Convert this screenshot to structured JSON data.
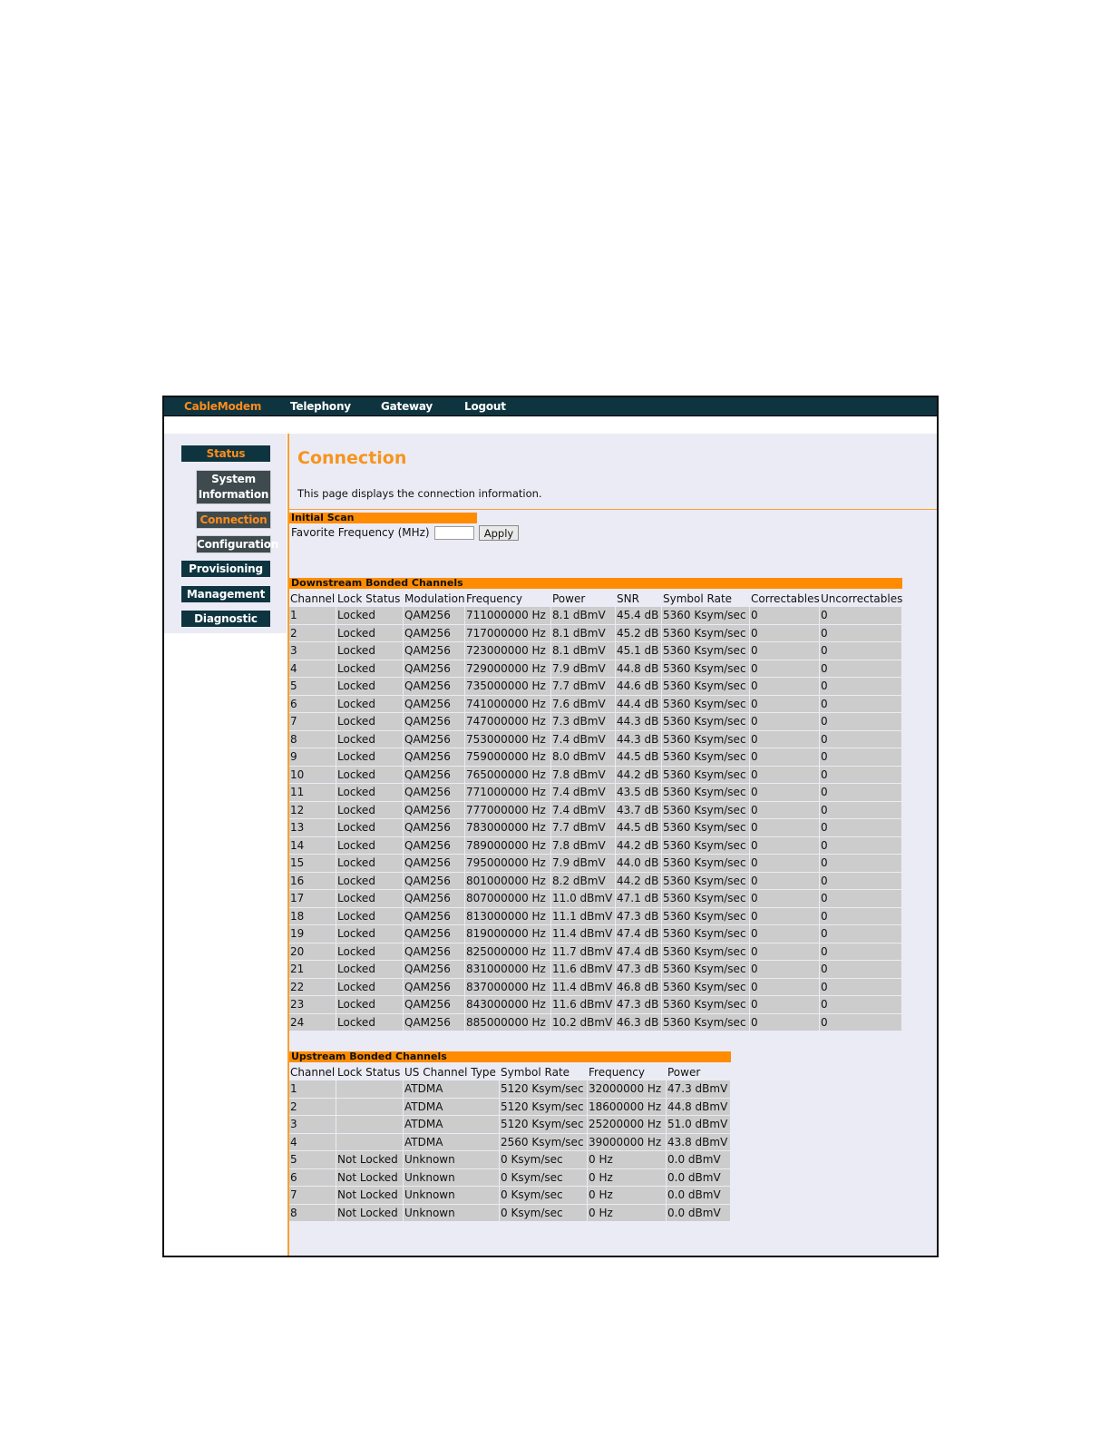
{
  "nav": {
    "tabs": [
      {
        "label": "CableModem",
        "active": true
      },
      {
        "label": "Telephony",
        "active": false
      },
      {
        "label": "Gateway",
        "active": false
      },
      {
        "label": "Logout",
        "active": false
      }
    ]
  },
  "sidebar": {
    "items": [
      {
        "label": "Status",
        "sub": false,
        "active": true
      },
      {
        "label": "System Information",
        "sub": true,
        "active": false
      },
      {
        "label": "Connection",
        "sub": true,
        "active": true
      },
      {
        "label": "Configuration",
        "sub": true,
        "active": false
      },
      {
        "label": "Provisioning",
        "sub": false,
        "active": false
      },
      {
        "label": "Management",
        "sub": false,
        "active": false
      },
      {
        "label": "Diagnostic",
        "sub": false,
        "active": false
      }
    ]
  },
  "page": {
    "title": "Connection",
    "description": "This page displays the connection information."
  },
  "initial_scan": {
    "heading": "Initial Scan",
    "favorite_label": "Favorite Frequency (MHz)",
    "favorite_value": "",
    "apply_label": "Apply"
  },
  "downstream": {
    "heading": "Downstream Bonded Channels",
    "columns": [
      "Channel",
      "Lock Status",
      "Modulation",
      "Frequency",
      "Power",
      "SNR",
      "Symbol Rate",
      "Correctables",
      "Uncorrectables"
    ],
    "rows": [
      [
        "1",
        "Locked",
        "QAM256",
        "711000000 Hz",
        "8.1 dBmV",
        "45.4 dB",
        "5360 Ksym/sec",
        "0",
        "0"
      ],
      [
        "2",
        "Locked",
        "QAM256",
        "717000000 Hz",
        "8.1 dBmV",
        "45.2 dB",
        "5360 Ksym/sec",
        "0",
        "0"
      ],
      [
        "3",
        "Locked",
        "QAM256",
        "723000000 Hz",
        "8.1 dBmV",
        "45.1 dB",
        "5360 Ksym/sec",
        "0",
        "0"
      ],
      [
        "4",
        "Locked",
        "QAM256",
        "729000000 Hz",
        "7.9 dBmV",
        "44.8 dB",
        "5360 Ksym/sec",
        "0",
        "0"
      ],
      [
        "5",
        "Locked",
        "QAM256",
        "735000000 Hz",
        "7.7 dBmV",
        "44.6 dB",
        "5360 Ksym/sec",
        "0",
        "0"
      ],
      [
        "6",
        "Locked",
        "QAM256",
        "741000000 Hz",
        "7.6 dBmV",
        "44.4 dB",
        "5360 Ksym/sec",
        "0",
        "0"
      ],
      [
        "7",
        "Locked",
        "QAM256",
        "747000000 Hz",
        "7.3 dBmV",
        "44.3 dB",
        "5360 Ksym/sec",
        "0",
        "0"
      ],
      [
        "8",
        "Locked",
        "QAM256",
        "753000000 Hz",
        "7.4 dBmV",
        "44.3 dB",
        "5360 Ksym/sec",
        "0",
        "0"
      ],
      [
        "9",
        "Locked",
        "QAM256",
        "759000000 Hz",
        "8.0 dBmV",
        "44.5 dB",
        "5360 Ksym/sec",
        "0",
        "0"
      ],
      [
        "10",
        "Locked",
        "QAM256",
        "765000000 Hz",
        "7.8 dBmV",
        "44.2 dB",
        "5360 Ksym/sec",
        "0",
        "0"
      ],
      [
        "11",
        "Locked",
        "QAM256",
        "771000000 Hz",
        "7.4 dBmV",
        "43.5 dB",
        "5360 Ksym/sec",
        "0",
        "0"
      ],
      [
        "12",
        "Locked",
        "QAM256",
        "777000000 Hz",
        "7.4 dBmV",
        "43.7 dB",
        "5360 Ksym/sec",
        "0",
        "0"
      ],
      [
        "13",
        "Locked",
        "QAM256",
        "783000000 Hz",
        "7.7 dBmV",
        "44.5 dB",
        "5360 Ksym/sec",
        "0",
        "0"
      ],
      [
        "14",
        "Locked",
        "QAM256",
        "789000000 Hz",
        "7.8 dBmV",
        "44.2 dB",
        "5360 Ksym/sec",
        "0",
        "0"
      ],
      [
        "15",
        "Locked",
        "QAM256",
        "795000000 Hz",
        "7.9 dBmV",
        "44.0 dB",
        "5360 Ksym/sec",
        "0",
        "0"
      ],
      [
        "16",
        "Locked",
        "QAM256",
        "801000000 Hz",
        "8.2 dBmV",
        "44.2 dB",
        "5360 Ksym/sec",
        "0",
        "0"
      ],
      [
        "17",
        "Locked",
        "QAM256",
        "807000000 Hz",
        "11.0 dBmV",
        "47.1 dB",
        "5360 Ksym/sec",
        "0",
        "0"
      ],
      [
        "18",
        "Locked",
        "QAM256",
        "813000000 Hz",
        "11.1 dBmV",
        "47.3 dB",
        "5360 Ksym/sec",
        "0",
        "0"
      ],
      [
        "19",
        "Locked",
        "QAM256",
        "819000000 Hz",
        "11.4 dBmV",
        "47.4 dB",
        "5360 Ksym/sec",
        "0",
        "0"
      ],
      [
        "20",
        "Locked",
        "QAM256",
        "825000000 Hz",
        "11.7 dBmV",
        "47.4 dB",
        "5360 Ksym/sec",
        "0",
        "0"
      ],
      [
        "21",
        "Locked",
        "QAM256",
        "831000000 Hz",
        "11.6 dBmV",
        "47.3 dB",
        "5360 Ksym/sec",
        "0",
        "0"
      ],
      [
        "22",
        "Locked",
        "QAM256",
        "837000000 Hz",
        "11.4 dBmV",
        "46.8 dB",
        "5360 Ksym/sec",
        "0",
        "0"
      ],
      [
        "23",
        "Locked",
        "QAM256",
        "843000000 Hz",
        "11.6 dBmV",
        "47.3 dB",
        "5360 Ksym/sec",
        "0",
        "0"
      ],
      [
        "24",
        "Locked",
        "QAM256",
        "885000000 Hz",
        "10.2 dBmV",
        "46.3 dB",
        "5360 Ksym/sec",
        "0",
        "0"
      ]
    ]
  },
  "upstream": {
    "heading": "Upstream Bonded Channels",
    "columns": [
      "Channel",
      "Lock Status",
      "US Channel Type",
      "Symbol Rate",
      "Frequency",
      "Power"
    ],
    "rows": [
      [
        "1",
        "",
        "ATDMA",
        "5120 Ksym/sec",
        "32000000 Hz",
        "47.3 dBmV"
      ],
      [
        "2",
        "",
        "ATDMA",
        "5120 Ksym/sec",
        "18600000 Hz",
        "44.8 dBmV"
      ],
      [
        "3",
        "",
        "ATDMA",
        "5120 Ksym/sec",
        "25200000 Hz",
        "51.0 dBmV"
      ],
      [
        "4",
        "",
        "ATDMA",
        "2560 Ksym/sec",
        "39000000 Hz",
        "43.8 dBmV"
      ],
      [
        "5",
        "Not Locked",
        "Unknown",
        "0 Ksym/sec",
        "0 Hz",
        "0.0 dBmV"
      ],
      [
        "6",
        "Not Locked",
        "Unknown",
        "0 Ksym/sec",
        "0 Hz",
        "0.0 dBmV"
      ],
      [
        "7",
        "Not Locked",
        "Unknown",
        "0 Ksym/sec",
        "0 Hz",
        "0.0 dBmV"
      ],
      [
        "8",
        "Not Locked",
        "Unknown",
        "0 Ksym/sec",
        "0 Hz",
        "0.0 dBmV"
      ]
    ]
  },
  "colors": {
    "nav_bg": "#0e3440",
    "accent_orange": "#ff8c00",
    "active_text": "#ff8c1a",
    "panel_bg": "#ebebf5",
    "cell_bg": "#cccccc"
  }
}
